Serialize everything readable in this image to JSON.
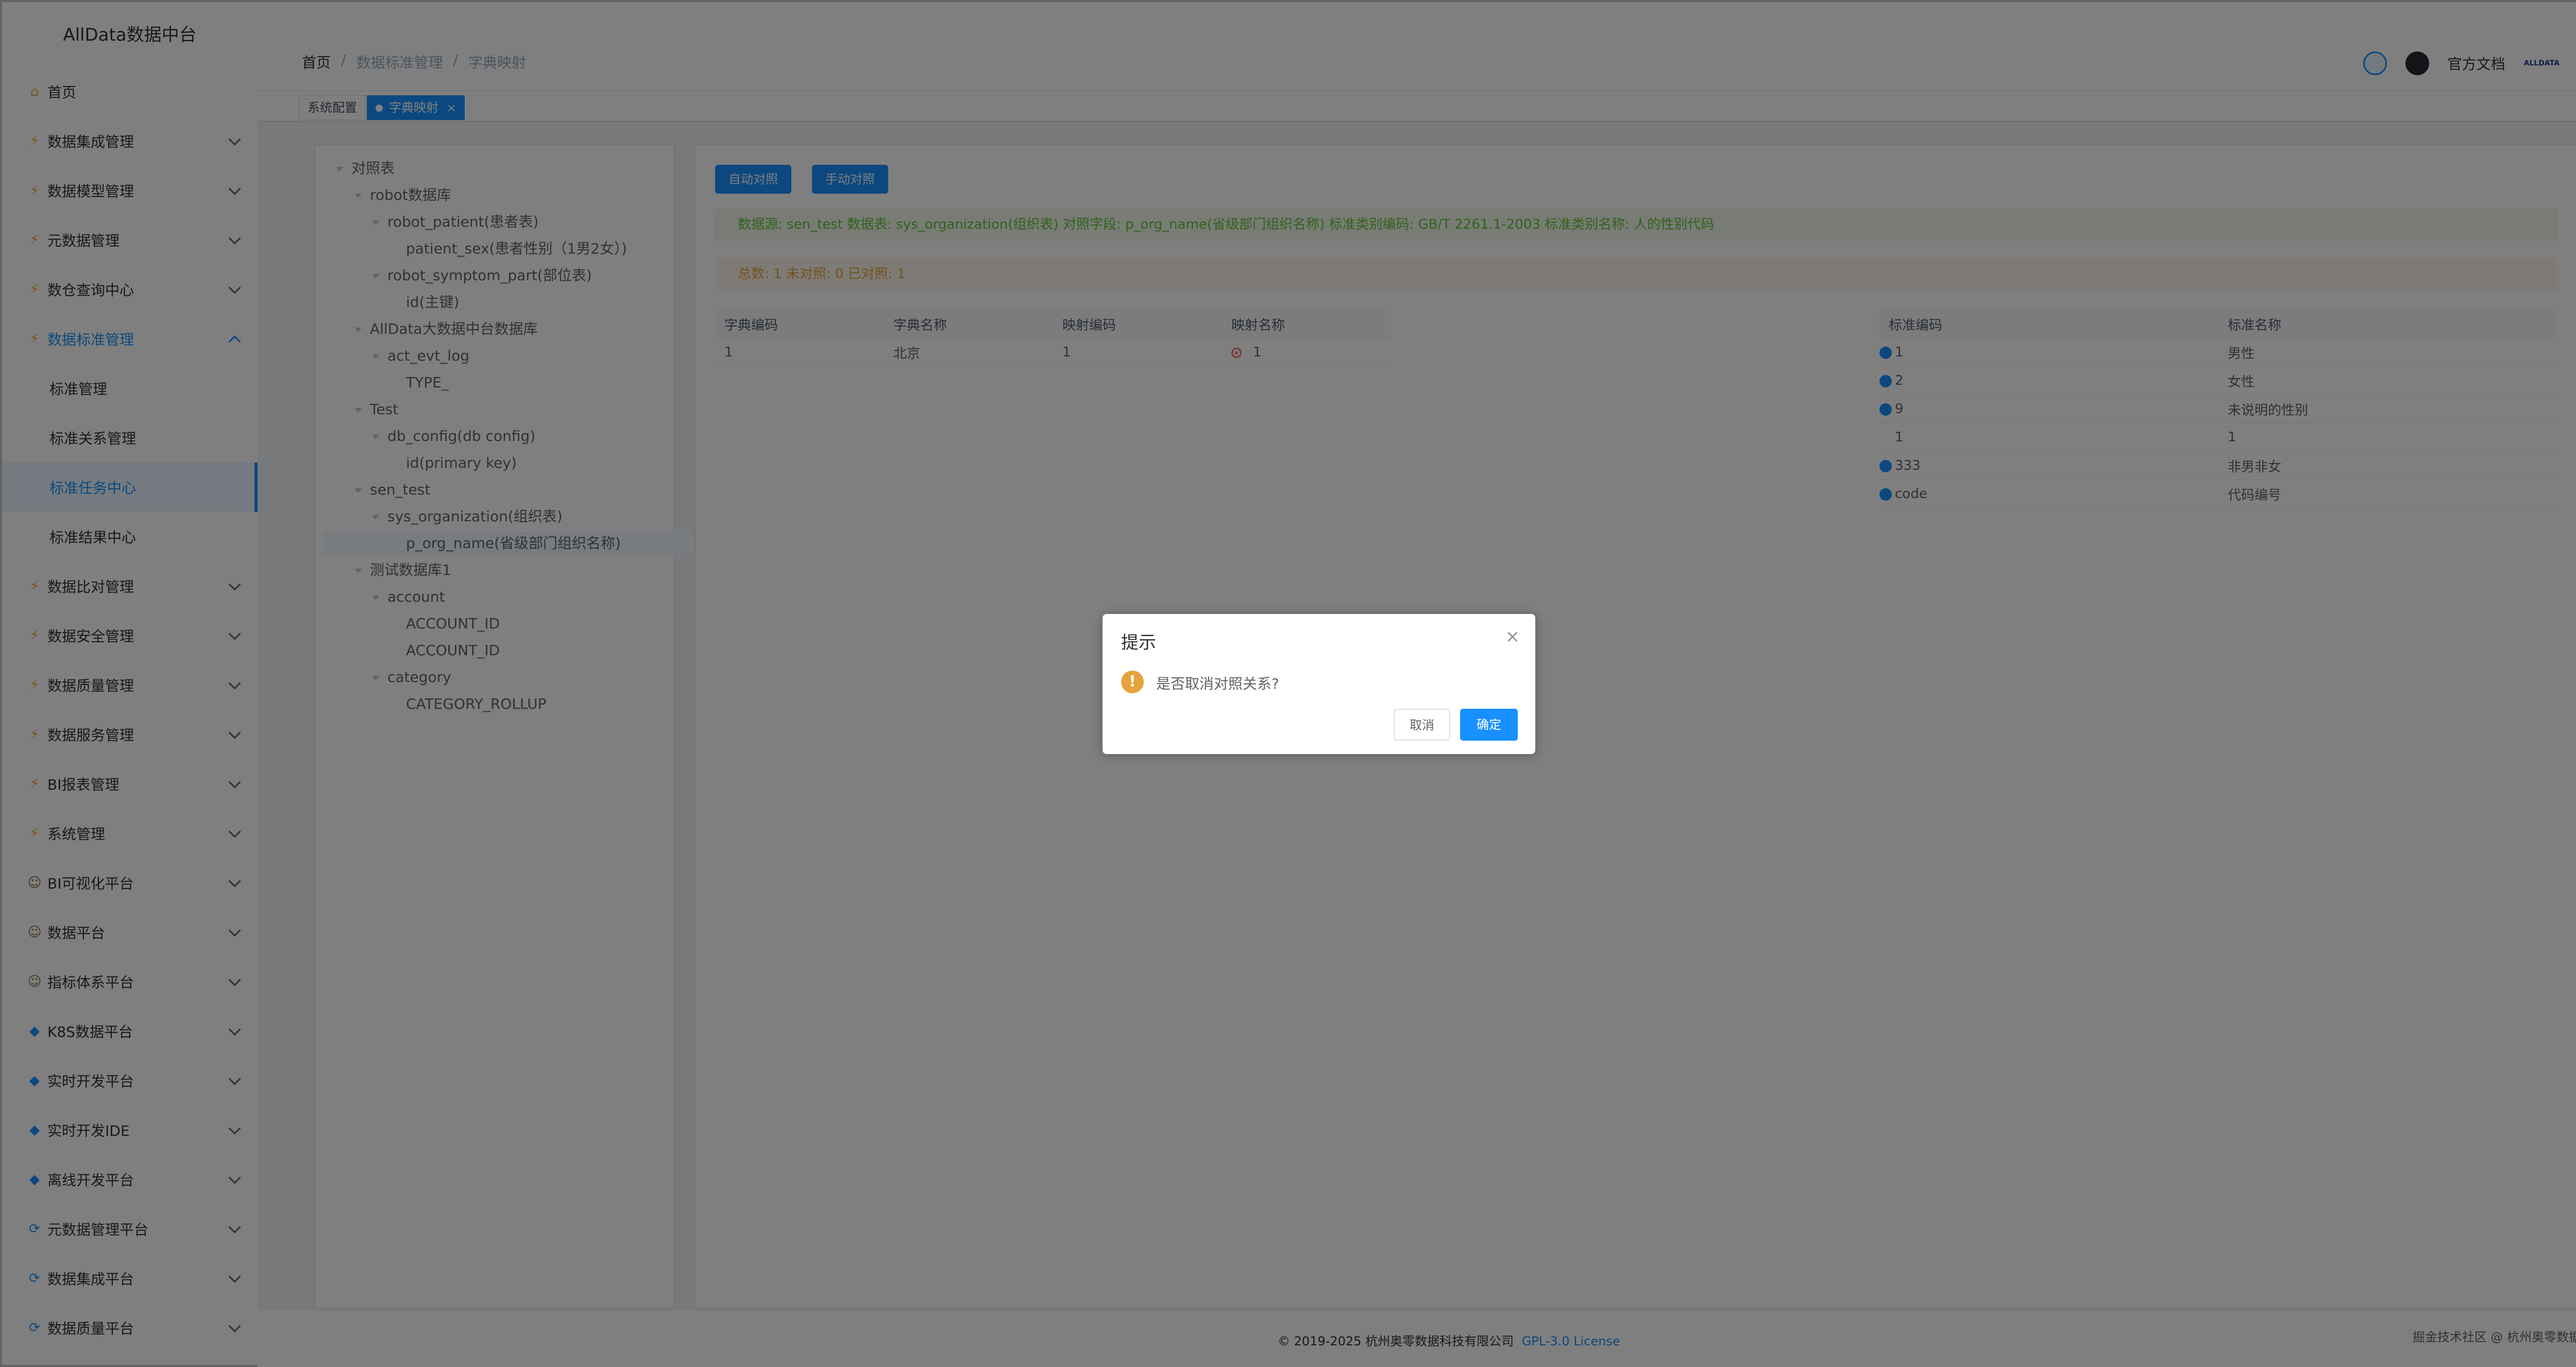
{
  "app": {
    "title": "AllData数据中台"
  },
  "sidebar": {
    "items": [
      {
        "label": "首页",
        "icon": "home-icon",
        "expandable": false
      },
      {
        "label": "数据集成管理",
        "icon": "lightning-icon",
        "expandable": true
      },
      {
        "label": "数据模型管理",
        "icon": "lightning-icon",
        "expandable": true
      },
      {
        "label": "元数据管理",
        "icon": "lightning-icon",
        "expandable": true
      },
      {
        "label": "数仓查询中心",
        "icon": "lightning-icon",
        "expandable": true
      },
      {
        "label": "数据标准管理",
        "icon": "lightning-icon",
        "expandable": true,
        "expanded": true
      },
      {
        "label": "标准管理",
        "sub": true
      },
      {
        "label": "标准关系管理",
        "sub": true
      },
      {
        "label": "标准任务中心",
        "sub": true,
        "active": true
      },
      {
        "label": "标准结果中心",
        "sub": true
      },
      {
        "label": "数据比对管理",
        "icon": "lightning-icon",
        "expandable": true
      },
      {
        "label": "数据安全管理",
        "icon": "lightning-icon",
        "expandable": true
      },
      {
        "label": "数据质量管理",
        "icon": "lightning-icon",
        "expandable": true
      },
      {
        "label": "数据服务管理",
        "icon": "lightning-icon",
        "expandable": true
      },
      {
        "label": "BI报表管理",
        "icon": "lightning-icon",
        "expandable": true
      },
      {
        "label": "系统管理",
        "icon": "lightning-icon",
        "expandable": true
      },
      {
        "label": "BI可视化平台",
        "icon": "person-icon",
        "expandable": true
      },
      {
        "label": "数据平台",
        "icon": "person-icon",
        "expandable": true
      },
      {
        "label": "指标体系平台",
        "icon": "person-icon",
        "expandable": true
      },
      {
        "label": "K8S数据平台",
        "icon": "diamond-icon",
        "expandable": true
      },
      {
        "label": "实时开发平台",
        "icon": "diamond-icon",
        "expandable": true
      },
      {
        "label": "实时开发IDE",
        "icon": "diamond-icon",
        "expandable": true
      },
      {
        "label": "离线开发平台",
        "icon": "diamond-icon",
        "expandable": true
      },
      {
        "label": "元数据管理平台",
        "icon": "cycle-icon",
        "expandable": true
      },
      {
        "label": "数据集成平台",
        "icon": "cycle-icon",
        "expandable": true
      },
      {
        "label": "数据质量平台",
        "icon": "cycle-icon",
        "expandable": true
      }
    ]
  },
  "breadcrumb": [
    "首页",
    "数据标准管理",
    "字典映射"
  ],
  "tags": [
    {
      "label": "系统配置",
      "active": false
    },
    {
      "label": "字典映射",
      "active": true
    }
  ],
  "navbar": {
    "docs_label": "官方文档",
    "logo_text": "ALLDATA"
  },
  "tree": [
    {
      "label": "对照表",
      "level": 0,
      "caret": true
    },
    {
      "label": "robot数据库",
      "level": 1,
      "caret": true
    },
    {
      "label": "robot_patient(患者表)",
      "level": 2,
      "caret": true
    },
    {
      "label": "patient_sex(患者性别（1男2女）)",
      "level": 3,
      "caret": false
    },
    {
      "label": "robot_symptom_part(部位表)",
      "level": 2,
      "caret": true
    },
    {
      "label": "id(主键)",
      "level": 3,
      "caret": false
    },
    {
      "label": "AllData大数据中台数据库",
      "level": 1,
      "caret": true
    },
    {
      "label": "act_evt_log",
      "level": 2,
      "caret": true
    },
    {
      "label": "TYPE_",
      "level": 3,
      "caret": false
    },
    {
      "label": "Test",
      "level": 1,
      "caret": true
    },
    {
      "label": "db_config(db config)",
      "level": 2,
      "caret": true
    },
    {
      "label": "id(primary key)",
      "level": 3,
      "caret": false
    },
    {
      "label": "sen_test",
      "level": 1,
      "caret": true
    },
    {
      "label": "sys_organization(组织表)",
      "level": 2,
      "caret": true
    },
    {
      "label": "p_org_name(省级部门组织名称)",
      "level": 3,
      "caret": false,
      "selected": true
    },
    {
      "label": "测试数据库1",
      "level": 1,
      "caret": true
    },
    {
      "label": "account",
      "level": 2,
      "caret": true
    },
    {
      "label": "ACCOUNT_ID",
      "level": 3,
      "caret": false
    },
    {
      "label": "ACCOUNT_ID",
      "level": 3,
      "caret": false
    },
    {
      "label": "category",
      "level": 2,
      "caret": true
    },
    {
      "label": "CATEGORY_ROLLUP",
      "level": 3,
      "caret": false
    }
  ],
  "buttons": {
    "auto_map": "自动对照",
    "manual_map": "手动对照"
  },
  "alerts": {
    "info": "数据源: sen_test 数据表: sys_organization(组织表) 对照字段: p_org_name(省级部门组织名称) 标准类别编码: GB/T 2261.1-2003 标准类别名称: 人的性别代码",
    "stats": "总数: 1 未对照: 0 已对照: 1"
  },
  "dict_table": {
    "headers": [
      "字典编码",
      "字典名称",
      "映射编码",
      "映射名称"
    ],
    "rows": [
      [
        "1",
        "北京",
        "1",
        "1"
      ]
    ]
  },
  "std_table": {
    "headers": [
      "标准编码",
      "标准名称"
    ],
    "rows": [
      {
        "code": "1",
        "name": "男性",
        "dot": true
      },
      {
        "code": "2",
        "name": "女性",
        "dot": true
      },
      {
        "code": "9",
        "name": "未说明的性别",
        "dot": true
      },
      {
        "code": "1",
        "name": "1",
        "dot": false
      },
      {
        "code": "333",
        "name": "非男非女",
        "dot": true
      },
      {
        "code": "code",
        "name": "代码编号",
        "dot": true
      }
    ]
  },
  "footer": {
    "copyright": "© 2019-2025 杭州奥零数据科技有限公司",
    "license": "GPL-3.0 License",
    "watermark": "掘金技术社区 @ 杭州奥零数据科技"
  },
  "dialog": {
    "title": "提示",
    "message": "是否取消对照关系?",
    "cancel": "取消",
    "confirm": "确定"
  },
  "colors": {
    "primary": "#1890ff",
    "success": "#67c23a",
    "warning": "#e6a23c"
  }
}
